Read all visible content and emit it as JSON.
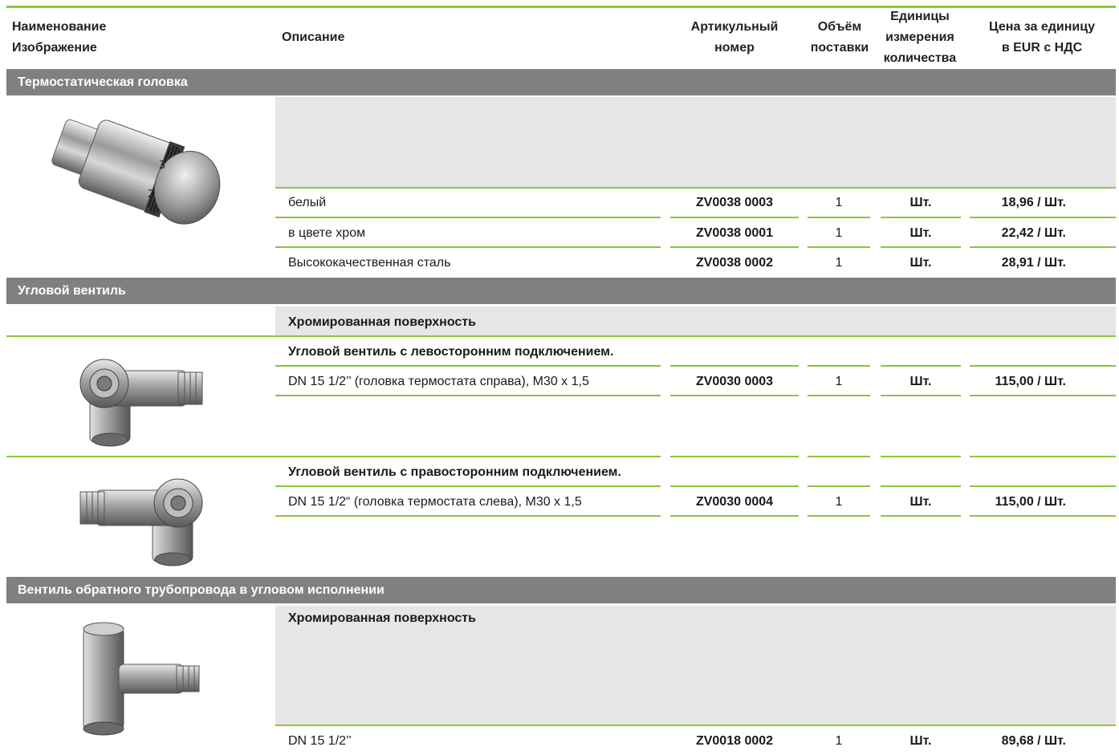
{
  "columns": {
    "name_line1": "Наименование",
    "name_line2": "Изображение",
    "description": "Описание",
    "article_line1": "Артикульный",
    "article_line2": "номер",
    "volume_line1": "Объём",
    "volume_line2": "поставки",
    "units_line1": "Единицы",
    "units_line2": "измерения",
    "units_line3": "количества",
    "price_line1": "Цена за единицу",
    "price_line2": "в EUR с НДС"
  },
  "sections": [
    {
      "title": "Термостатическая головка",
      "image_icon": "thermostatic-head",
      "rows": [
        {
          "description": "белый",
          "article": "ZV0038 0003",
          "qty": "1",
          "unit": "Шт.",
          "price": "18,96 / Шт."
        },
        {
          "description": "в цвете хром",
          "article": "ZV0038 0001",
          "qty": "1",
          "unit": "Шт.",
          "price": "22,42 / Шт."
        },
        {
          "description": "Высококачественная сталь",
          "article": "ZV0038 0002",
          "qty": "1",
          "unit": "Шт.",
          "price": "28,91 / Шт."
        }
      ]
    },
    {
      "title": "Угловой вентиль",
      "surface": "Хромированная поверхность",
      "groups": [
        {
          "image_icon": "angle-valve-left",
          "heading": "Угловой вентиль с левосторонним подключением.",
          "row": {
            "description": "DN 15 1/2’’ (головка термостата справа), M30 x 1,5",
            "article": "ZV0030 0003",
            "qty": "1",
            "unit": "Шт.",
            "price": "115,00 / Шт."
          }
        },
        {
          "image_icon": "angle-valve-right",
          "heading": "Угловой вентиль с правосторонним подключением.",
          "row": {
            "description": "DN 15 1/2“ (головка термостата слева), M30 x 1,5",
            "article": "ZV0030 0004",
            "qty": "1",
            "unit": "Шт.",
            "price": "115,00 / Шт."
          }
        }
      ]
    },
    {
      "title": "Вентиль обратного трубопровода в угловом исполнении",
      "surface": "Хромированная поверхность",
      "image_icon": "return-valve",
      "row": {
        "description": "DN 15 1/2’’",
        "article": "ZV0018 0002",
        "qty": "1",
        "unit": "Шт.",
        "price": "89,68 / Шт."
      }
    }
  ]
}
